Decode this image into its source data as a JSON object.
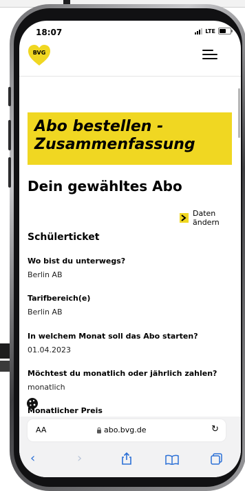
{
  "status_bar": {
    "time": "18:07",
    "network": "LTE"
  },
  "header": {
    "logo": "BVG"
  },
  "page": {
    "heading_line1": "Abo bestellen -",
    "heading_line2": "Zusammenfassung",
    "section_title": "Dein gewähltes Abo",
    "change_link": "Daten ändern",
    "ticket_name": "Schülerticket"
  },
  "details": [
    {
      "question": "Wo bist du unterwegs?",
      "answer": "Berlin AB"
    },
    {
      "question": "Tarifbereich(e)",
      "answer": "Berlin AB"
    },
    {
      "question": "In welchem Monat soll das Abo starten?",
      "answer": "01.04.2023"
    },
    {
      "question": "Möchtest du monatlich oder jährlich zahlen?",
      "answer": "monatlich"
    },
    {
      "question": "Monatlicher Preis"
    }
  ],
  "browser": {
    "text_size": "AA",
    "url": "abo.bvg.de"
  },
  "colors": {
    "brand_yellow": "#f0d722",
    "link_blue": "#2a6fd6"
  }
}
